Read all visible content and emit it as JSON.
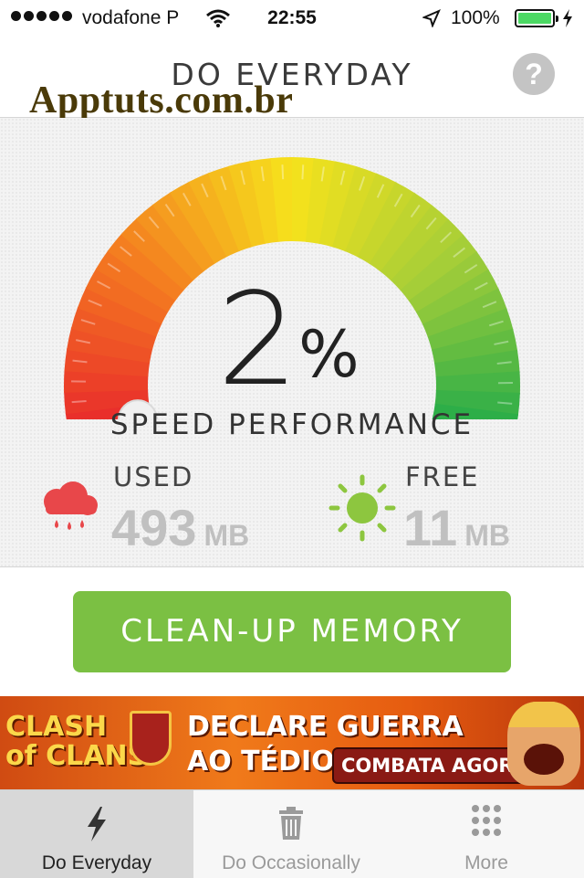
{
  "status_bar": {
    "carrier": "vodafone P",
    "time": "22:55",
    "battery": "100%"
  },
  "header": {
    "title": "DO EVERYDAY",
    "help_icon": "?"
  },
  "watermark": "Apptuts.com.br",
  "gauge": {
    "percent": "2",
    "percent_sign": "%",
    "caption": "SPEED PERFORMANCE",
    "level": 0.02
  },
  "memory": {
    "used_label": "USED",
    "used_value": "493",
    "used_unit": "MB",
    "free_label": "FREE",
    "free_value": "11",
    "free_unit": "MB",
    "used_icon": "rain-cloud-icon",
    "free_icon": "sun-icon"
  },
  "clean_button": "CLEAN-UP MEMORY",
  "ad": {
    "brand_line1": "CLASH",
    "brand_line2": "of CLANS",
    "headline_1": "DECLARE GUERRA",
    "headline_2": "AO TÉDIO",
    "cta": "COMBATA AGORA"
  },
  "tabs": [
    {
      "label": "Do Everyday",
      "icon": "lightning-icon",
      "active": true
    },
    {
      "label": "Do Occasionally",
      "icon": "trash-icon",
      "active": false
    },
    {
      "label": "More",
      "icon": "grid-dots-icon",
      "active": false
    }
  ],
  "colors": {
    "accent_green": "#7bc043",
    "gauge_low": "#e8262c",
    "gauge_mid": "#f6e21c",
    "gauge_high": "#1faa4a",
    "used_icon": "#e8474a",
    "free_icon": "#8dc63f",
    "needle": "#3aa6d8"
  }
}
